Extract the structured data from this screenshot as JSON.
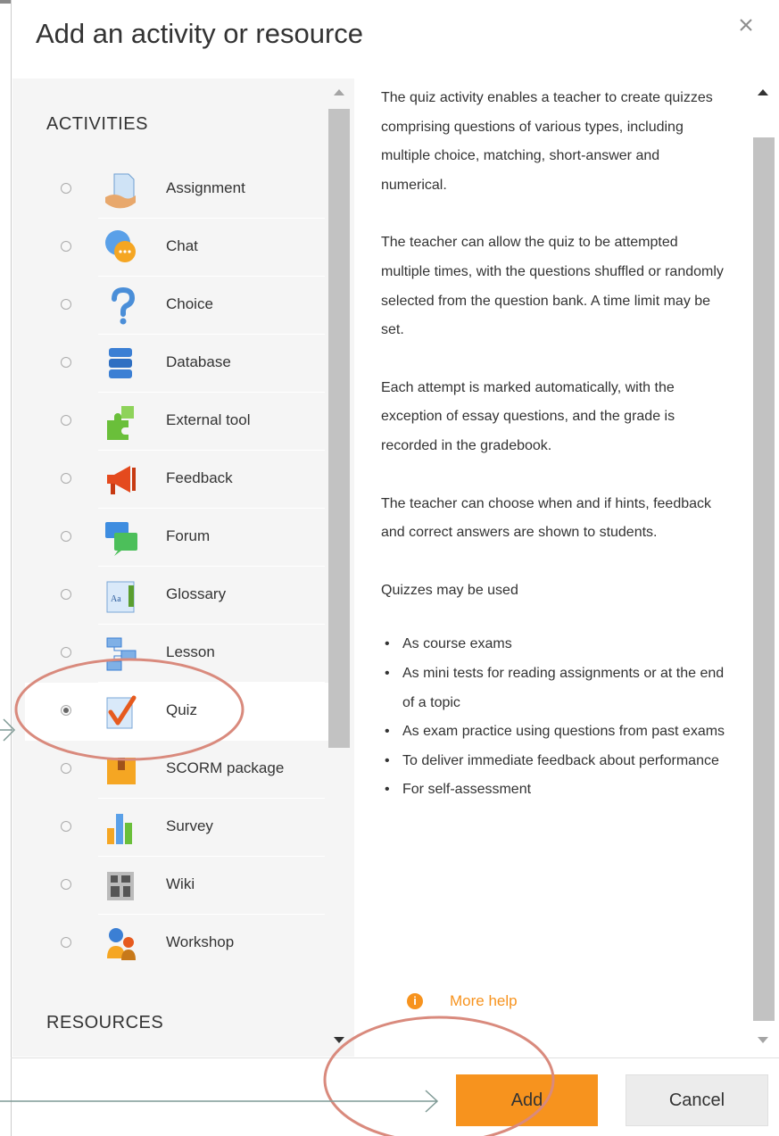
{
  "dialog": {
    "title": "Add an activity or resource",
    "close_label": "×"
  },
  "left": {
    "activities_header": "ACTIVITIES",
    "resources_header": "RESOURCES",
    "items": [
      {
        "label": "Assignment",
        "icon": "assignment-icon",
        "selected": false
      },
      {
        "label": "Chat",
        "icon": "chat-icon",
        "selected": false
      },
      {
        "label": "Choice",
        "icon": "choice-icon",
        "selected": false
      },
      {
        "label": "Database",
        "icon": "database-icon",
        "selected": false
      },
      {
        "label": "External tool",
        "icon": "external-tool-icon",
        "selected": false
      },
      {
        "label": "Feedback",
        "icon": "feedback-icon",
        "selected": false
      },
      {
        "label": "Forum",
        "icon": "forum-icon",
        "selected": false
      },
      {
        "label": "Glossary",
        "icon": "glossary-icon",
        "selected": false
      },
      {
        "label": "Lesson",
        "icon": "lesson-icon",
        "selected": false
      },
      {
        "label": "Quiz",
        "icon": "quiz-icon",
        "selected": true
      },
      {
        "label": "SCORM package",
        "icon": "scorm-icon",
        "selected": false
      },
      {
        "label": "Survey",
        "icon": "survey-icon",
        "selected": false
      },
      {
        "label": "Wiki",
        "icon": "wiki-icon",
        "selected": false
      },
      {
        "label": "Workshop",
        "icon": "workshop-icon",
        "selected": false
      }
    ]
  },
  "description": {
    "paragraphs": [
      "The quiz activity enables a teacher to create quizzes comprising questions of various types, including multiple choice, matching, short-answer and numerical.",
      "The teacher can allow the quiz to be attempted multiple times, with the questions shuffled or randomly selected from the question bank. A time limit may be set.",
      "Each attempt is marked automatically, with the exception of essay questions, and the grade is recorded in the gradebook.",
      "The teacher can choose when and if hints, feedback and correct answers are shown to students.",
      "Quizzes may be used"
    ],
    "bullets": [
      "As course exams",
      "As mini tests for reading assignments or at the end of a topic",
      "As exam practice using questions from past exams",
      "To deliver immediate feedback about performance",
      "For self-assessment"
    ],
    "more_help": "More help"
  },
  "footer": {
    "add_label": "Add",
    "cancel_label": "Cancel"
  },
  "colors": {
    "accent": "#f7931e",
    "annotation": "#d98a7d",
    "arrow": "#7f9a95"
  }
}
